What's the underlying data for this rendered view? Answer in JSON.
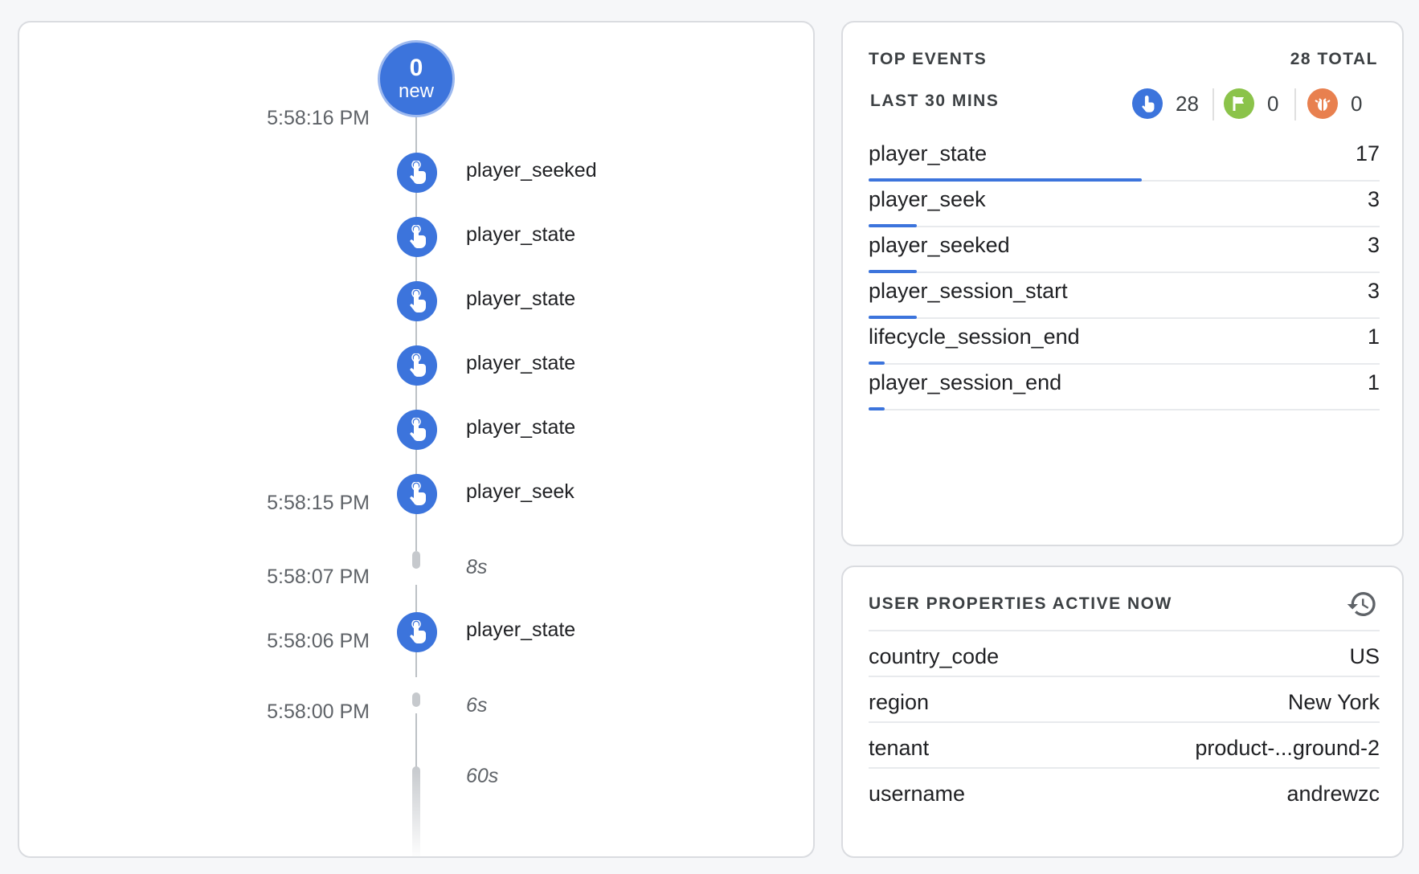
{
  "timeline": {
    "new_count": "0",
    "new_label": "new",
    "timestamps": [
      "5:58:16 PM",
      "5:58:15 PM",
      "5:58:07 PM",
      "5:58:06 PM",
      "5:58:00 PM"
    ],
    "events": [
      "player_seeked",
      "player_state",
      "player_state",
      "player_state",
      "player_state",
      "player_seek",
      "player_state"
    ],
    "gaps": [
      "8s",
      "6s",
      "60s"
    ],
    "event_icon": "touch-icon"
  },
  "top_events": {
    "title": "TOP EVENTS",
    "total": "28 TOTAL",
    "range": "LAST 30 MINS",
    "stats": [
      {
        "icon": "touch-icon",
        "color": "#3c74dc",
        "value": "28"
      },
      {
        "icon": "flag-icon",
        "color": "#8bc34a",
        "value": "0"
      },
      {
        "icon": "bug-icon",
        "color": "#e8804f",
        "value": "0"
      }
    ],
    "rows": [
      {
        "name": "player_state",
        "count": "17",
        "share": 1.0
      },
      {
        "name": "player_seek",
        "count": "3",
        "share": 0.176
      },
      {
        "name": "player_seeked",
        "count": "3",
        "share": 0.176
      },
      {
        "name": "player_session_start",
        "count": "3",
        "share": 0.176
      },
      {
        "name": "lifecycle_session_end",
        "count": "1",
        "share": 0.059
      },
      {
        "name": "player_session_end",
        "count": "1",
        "share": 0.059
      }
    ],
    "accent": "#3c74dc"
  },
  "user_properties": {
    "title": "USER PROPERTIES ACTIVE NOW",
    "history_icon": "history-icon",
    "rows": [
      {
        "key": "country_code",
        "value": "US"
      },
      {
        "key": "region",
        "value": "New York"
      },
      {
        "key": "tenant",
        "value": "product-...ground-2"
      },
      {
        "key": "username",
        "value": "andrewzc"
      }
    ]
  }
}
